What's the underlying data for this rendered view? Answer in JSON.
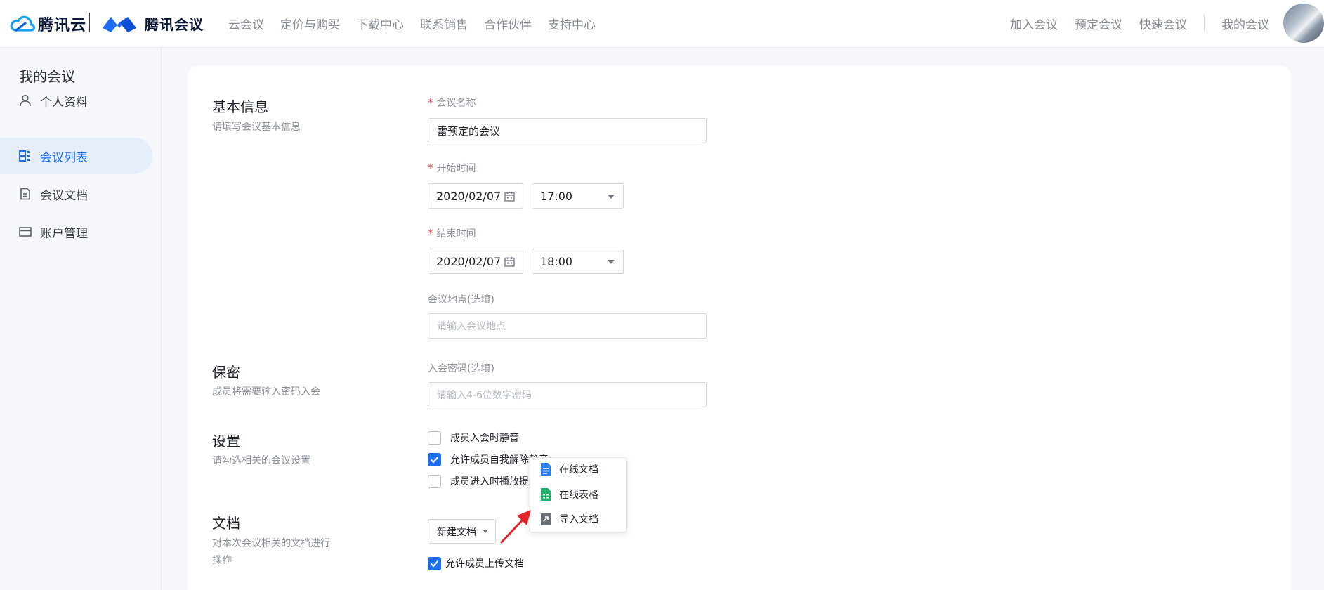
{
  "brand": {
    "tencent_cloud": "腾讯云",
    "tencent_meeting": "腾讯会议"
  },
  "nav": {
    "left": [
      "云会议",
      "定价与购买",
      "下载中心",
      "联系销售",
      "合作伙伴",
      "支持中心"
    ],
    "right": [
      "加入会议",
      "预定会议",
      "快速会议",
      "我的会议"
    ]
  },
  "sidebar": {
    "title": "我的会议",
    "items": [
      {
        "label": "个人资料",
        "icon": "user-icon",
        "active": false
      },
      {
        "label": "会议列表",
        "icon": "list-icon",
        "active": true
      },
      {
        "label": "会议文档",
        "icon": "document-icon",
        "active": false
      },
      {
        "label": "账户管理",
        "icon": "card-icon",
        "active": false
      }
    ]
  },
  "basic": {
    "title": "基本信息",
    "desc": "请填写会议基本信息",
    "name_label": "会议名称",
    "name_value": "雷预定的会议",
    "start_label": "开始时间",
    "start_date": "2020/02/07",
    "start_time": "17:00",
    "end_label": "结束时间",
    "end_date": "2020/02/07",
    "end_time": "18:00",
    "location_label": "会议地点(选填)",
    "location_placeholder": "请输入会议地点"
  },
  "security": {
    "title": "保密",
    "desc": "成员将需要输入密码入会",
    "password_label": "入会密码(选填)",
    "password_placeholder": "请输入4-6位数字密码"
  },
  "settings": {
    "title": "设置",
    "desc": "请勾选相关的会议设置",
    "options": [
      {
        "label": "成员入会时静音",
        "checked": false
      },
      {
        "label": "允许成员自我解除静音",
        "checked": true
      },
      {
        "label": "成员进入时播放提示音",
        "checked": false
      }
    ]
  },
  "docs": {
    "title": "文档",
    "desc": "对本次会议相关的文档进行操作",
    "new_doc_label": "新建文档",
    "allow_upload_label": "允许成员上传文档",
    "allow_upload_checked": true,
    "menu": [
      {
        "label": "在线文档",
        "icon": "online-doc-icon",
        "color": "#2b7cf6"
      },
      {
        "label": "在线表格",
        "icon": "online-sheet-icon",
        "color": "#1fb36a"
      },
      {
        "label": "导入文档",
        "icon": "import-doc-icon",
        "color": "#6b6f78"
      }
    ]
  },
  "colors": {
    "accent": "#1a6cf0",
    "required": "#e34d4d",
    "annotation_arrow": "#e5242b"
  }
}
